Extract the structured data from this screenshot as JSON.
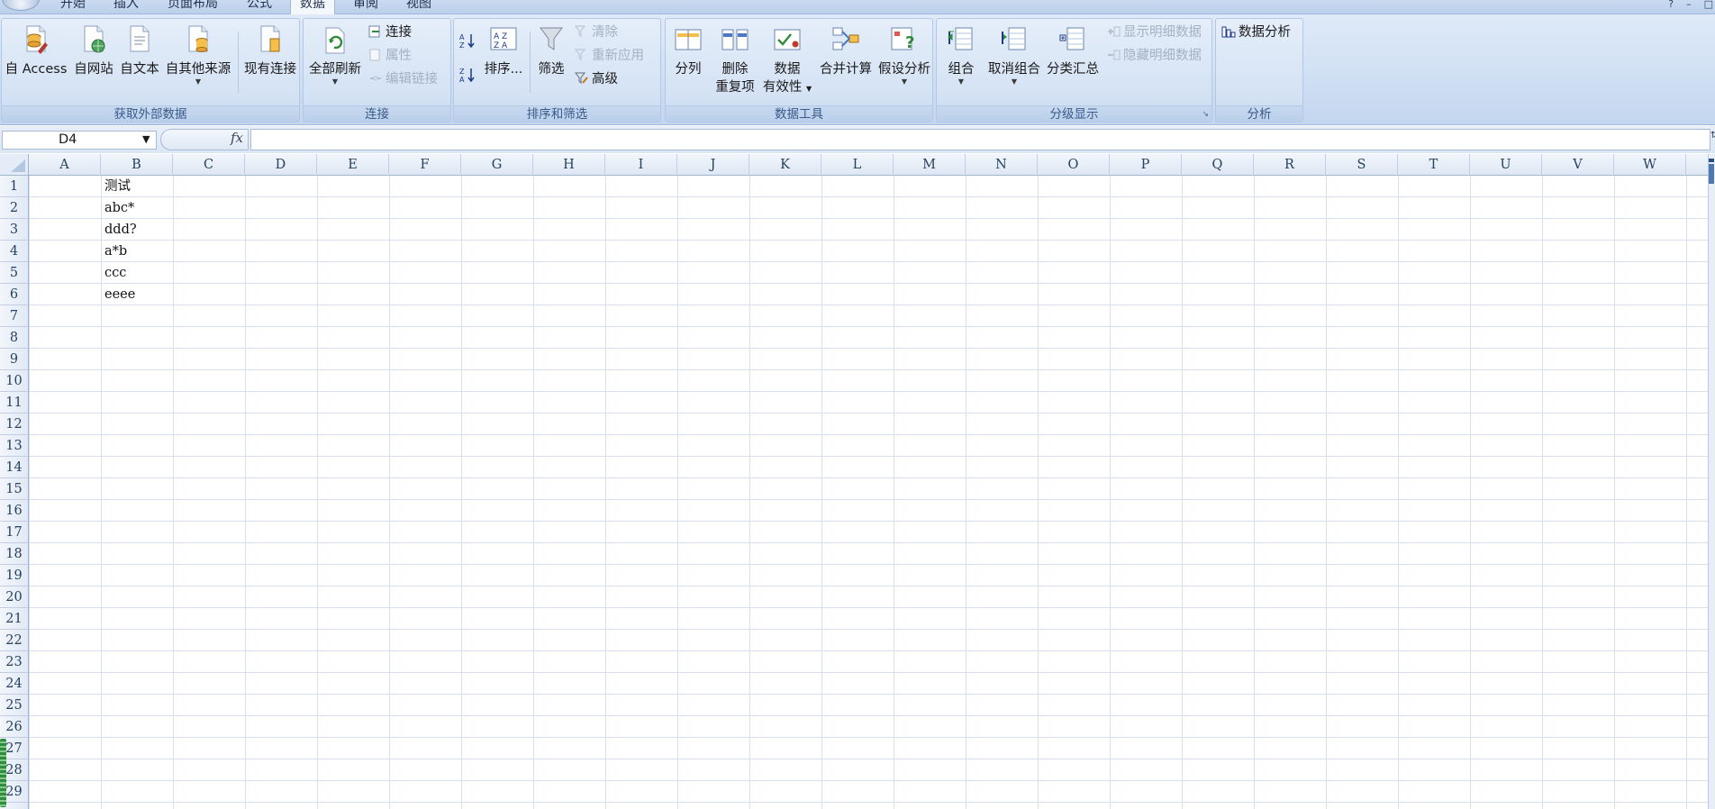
{
  "tabs": [
    {
      "label": "开始"
    },
    {
      "label": "插入"
    },
    {
      "label": "页面布局"
    },
    {
      "label": "公式"
    },
    {
      "label": "数据"
    },
    {
      "label": "审阅"
    },
    {
      "label": "视图"
    }
  ],
  "active_tab": "数据",
  "ribbon": {
    "external": {
      "group_label": "获取外部数据",
      "from_access": "自 Access",
      "from_web": "自网站",
      "from_text": "自文本",
      "from_other": "自其他来源",
      "existing_connections": "现有连接"
    },
    "connections": {
      "group_label": "连接",
      "refresh_all": "全部刷新",
      "connections": "连接",
      "properties": "属性",
      "edit_links": "编辑链接"
    },
    "sort_filter": {
      "group_label": "排序和筛选",
      "sort": "排序...",
      "filter": "筛选",
      "clear": "清除",
      "reapply": "重新应用",
      "advanced": "高级"
    },
    "data_tools": {
      "group_label": "数据工具",
      "text_to_columns": "分列",
      "remove_duplicates_1": "删除",
      "remove_duplicates_2": "重复项",
      "validation_1": "数据",
      "validation_2": "有效性",
      "consolidate": "合并计算",
      "what_if": "假设分析"
    },
    "outline": {
      "group_label": "分级显示",
      "group": "组合",
      "ungroup": "取消组合",
      "subtotal": "分类汇总",
      "show_detail": "显示明细数据",
      "hide_detail": "隐藏明细数据"
    },
    "analysis": {
      "group_label": "分析",
      "data_analysis": "数据分析"
    }
  },
  "formula_bar": {
    "name_box": "D4",
    "fx": "fx",
    "formula": ""
  },
  "columns": [
    "A",
    "B",
    "C",
    "D",
    "E",
    "F",
    "G",
    "H",
    "I",
    "J",
    "K",
    "L",
    "M",
    "N",
    "O",
    "P",
    "Q",
    "R",
    "S",
    "T",
    "U",
    "V",
    "W"
  ],
  "rows": [
    "1",
    "2",
    "3",
    "4",
    "5",
    "6",
    "7",
    "8",
    "9",
    "10",
    "11",
    "12",
    "13",
    "14",
    "15",
    "16",
    "17",
    "18",
    "19",
    "20",
    "21",
    "22",
    "23",
    "24",
    "25",
    "26",
    "27",
    "28",
    "29"
  ],
  "cells_b": [
    "测试",
    "abc*",
    "ddd?",
    "a*b",
    "ccc",
    "eeee"
  ]
}
